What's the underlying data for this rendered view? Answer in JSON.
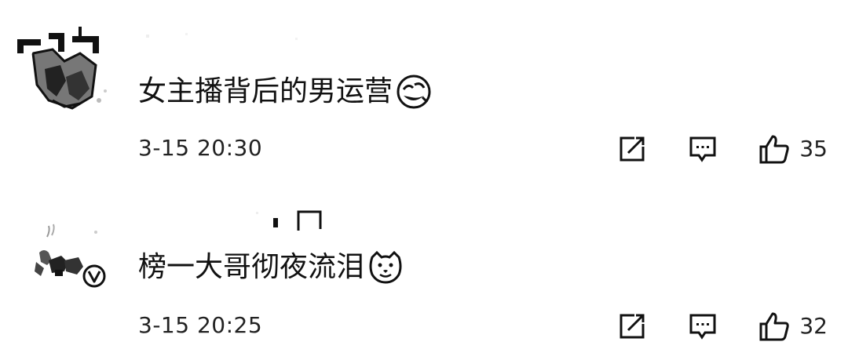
{
  "comments": [
    {
      "content": "女主播背后的男运营",
      "emoji_icon": "laughing-face-icon",
      "timestamp": "3-15 20:30",
      "likes": "35",
      "verified": false
    },
    {
      "content": "榜一大哥彻夜流泪",
      "emoji_icon": "doge-face-icon",
      "timestamp": "3-15 20:25",
      "likes": "32",
      "verified": true
    }
  ],
  "icons": {
    "forward": "forward-icon",
    "reply": "reply-icon",
    "like": "thumbs-up-icon",
    "verified": "verified-badge-icon"
  }
}
